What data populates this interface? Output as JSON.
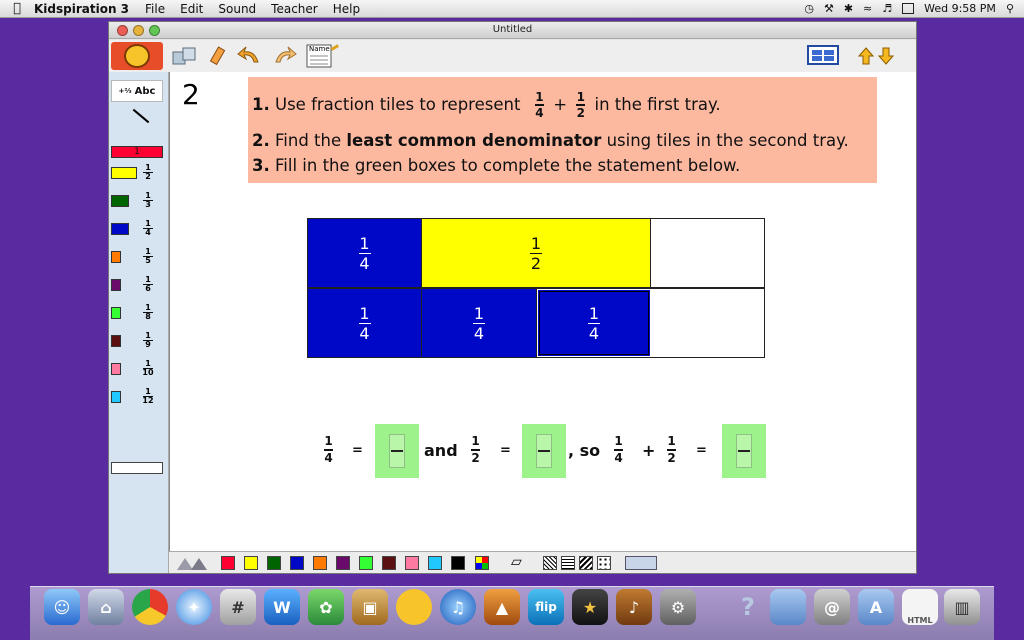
{
  "menubar": {
    "app_name": "Kidspiration 3",
    "items": [
      "File",
      "Edit",
      "Sound",
      "Teacher",
      "Help"
    ],
    "clock": "Wed 9:58 PM"
  },
  "window": {
    "title": "Untitled",
    "name_tool_label": "Name"
  },
  "palette": {
    "abc_label": "Abc",
    "whole_label": "1",
    "tiles": [
      {
        "color": "#ffff00",
        "num": "1",
        "den": "2"
      },
      {
        "color": "#006400",
        "num": "1",
        "den": "3"
      },
      {
        "color": "#0008c8",
        "num": "1",
        "den": "4"
      },
      {
        "color": "#ff7a00",
        "num": "1",
        "den": "5"
      },
      {
        "color": "#6a0a6a",
        "num": "1",
        "den": "6"
      },
      {
        "color": "#33ff33",
        "num": "1",
        "den": "8"
      },
      {
        "color": "#5a1010",
        "num": "1",
        "den": "9"
      },
      {
        "color": "#ff7aa0",
        "num": "1",
        "den": "10"
      },
      {
        "color": "#20c8ff",
        "num": "1",
        "den": "12"
      }
    ]
  },
  "question": {
    "number": "2",
    "line1_num": "1.",
    "line1_text_a": "Use fraction tiles to represent",
    "frac_a_num": "1",
    "frac_a_den": "4",
    "plus": "+",
    "frac_b_num": "1",
    "frac_b_den": "2",
    "line1_text_b": "in the first tray.",
    "line2_num": "2.",
    "line2_text_a": "Find the",
    "line2_bold": "least common denominator",
    "line2_text_b": "using tiles in the second tray.",
    "line3_num": "3.",
    "line3_text": "Fill in the green boxes to complete the statement below."
  },
  "tray1": {
    "tiles": [
      {
        "num": "1",
        "den": "4"
      },
      {
        "num": "1",
        "den": "2"
      }
    ]
  },
  "tray2": {
    "tiles": [
      {
        "num": "1",
        "den": "4"
      },
      {
        "num": "1",
        "den": "4"
      },
      {
        "num": "1",
        "den": "4"
      }
    ]
  },
  "statement": {
    "f1_num": "1",
    "f1_den": "4",
    "eq1": "=",
    "and": "and",
    "f2_num": "1",
    "f2_den": "2",
    "eq2": "=",
    "so": ", so",
    "f3_num": "1",
    "f3_den": "4",
    "plus": "+",
    "f4_num": "1",
    "f4_den": "2",
    "eq3": "="
  },
  "colors": [
    "#ff0033",
    "#ffff00",
    "#006400",
    "#0008c8",
    "#ff7a00",
    "#6a0a6a",
    "#33ff33",
    "#5a1010",
    "#ff7aa0",
    "#20c8ff",
    "#000000"
  ]
}
